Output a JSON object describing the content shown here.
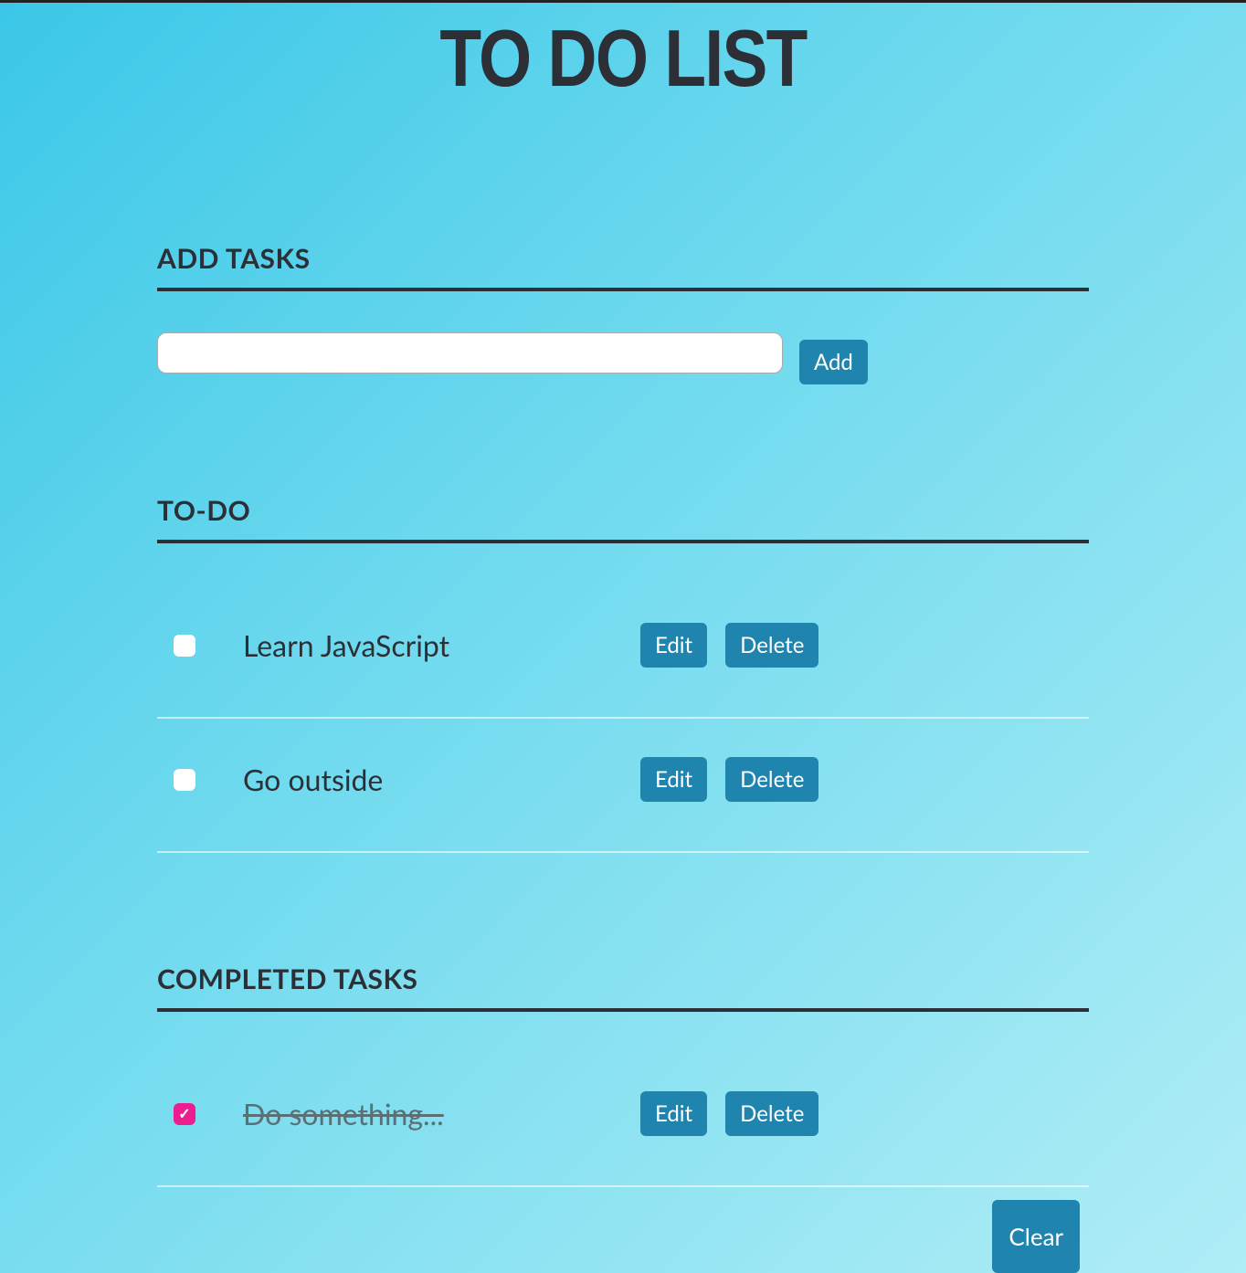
{
  "title": "TO DO LIST",
  "sections": {
    "add": {
      "heading": "ADD TASKS",
      "input_value": "",
      "add_button": "Add"
    },
    "todo": {
      "heading": "TO-DO",
      "items": [
        {
          "text": "Learn JavaScript",
          "completed": false
        },
        {
          "text": "Go outside",
          "completed": false
        }
      ]
    },
    "completed": {
      "heading": "COMPLETED TASKS",
      "items": [
        {
          "text": "Do something...",
          "completed": true
        }
      ],
      "clear_button": "Clear"
    }
  },
  "buttons": {
    "edit": "Edit",
    "delete": "Delete"
  },
  "colors": {
    "accent": "#1f84ae",
    "checkbox_checked": "#ec1e8f",
    "text": "#2c3036"
  }
}
